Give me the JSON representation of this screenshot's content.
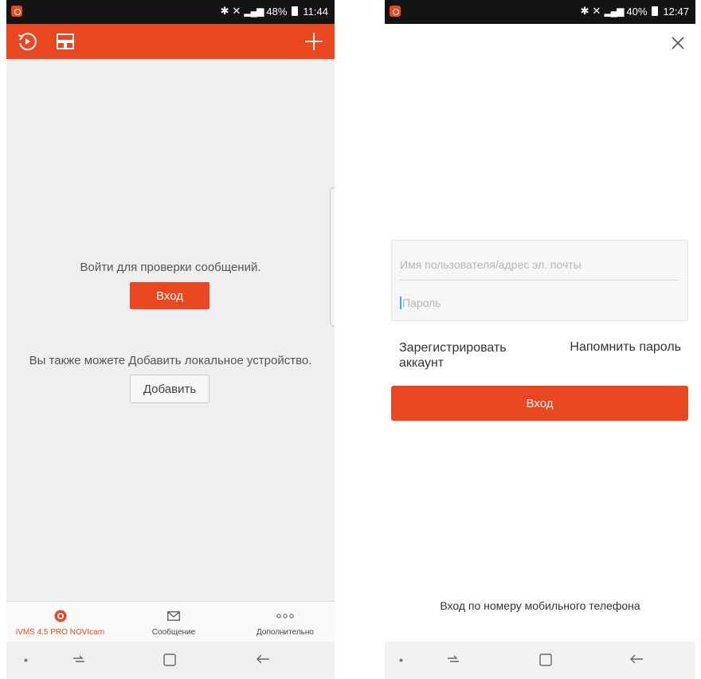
{
  "left_screen": {
    "status": {
      "time": "11:44",
      "battery": "48%"
    },
    "toolbar": {
      "history_icon": "playback-icon",
      "layout_icon": "layout-split-icon",
      "add_icon": "plus-icon"
    },
    "login_prompt": "Войти для проверки сообщений.",
    "login_button": "Вход",
    "local_prompt": "Вы также можете Добавить локальное устройство.",
    "add_button": "Добавить",
    "tabs": [
      {
        "label": "iVMS 4.5 PRO NOVIcam",
        "icon": "live-view-icon",
        "active": true
      },
      {
        "label": "Сообщение",
        "icon": "envelope-icon",
        "active": false
      },
      {
        "label": "Дополнительно",
        "icon": "more-dots-icon",
        "active": false
      }
    ]
  },
  "right_screen": {
    "status": {
      "time": "12:47",
      "battery": "40%"
    },
    "username_placeholder": "Имя пользователя/адрес эл. почты",
    "password_placeholder": "Пароль",
    "register_link": "Зарегистрировать аккаунт",
    "forgot_link": "Напомнить пароль",
    "login_button": "Вход",
    "phone_login_link": "Вход по номеру мобильного телефона"
  },
  "colors": {
    "accent": "#e8471f",
    "background": "#efeff1"
  }
}
